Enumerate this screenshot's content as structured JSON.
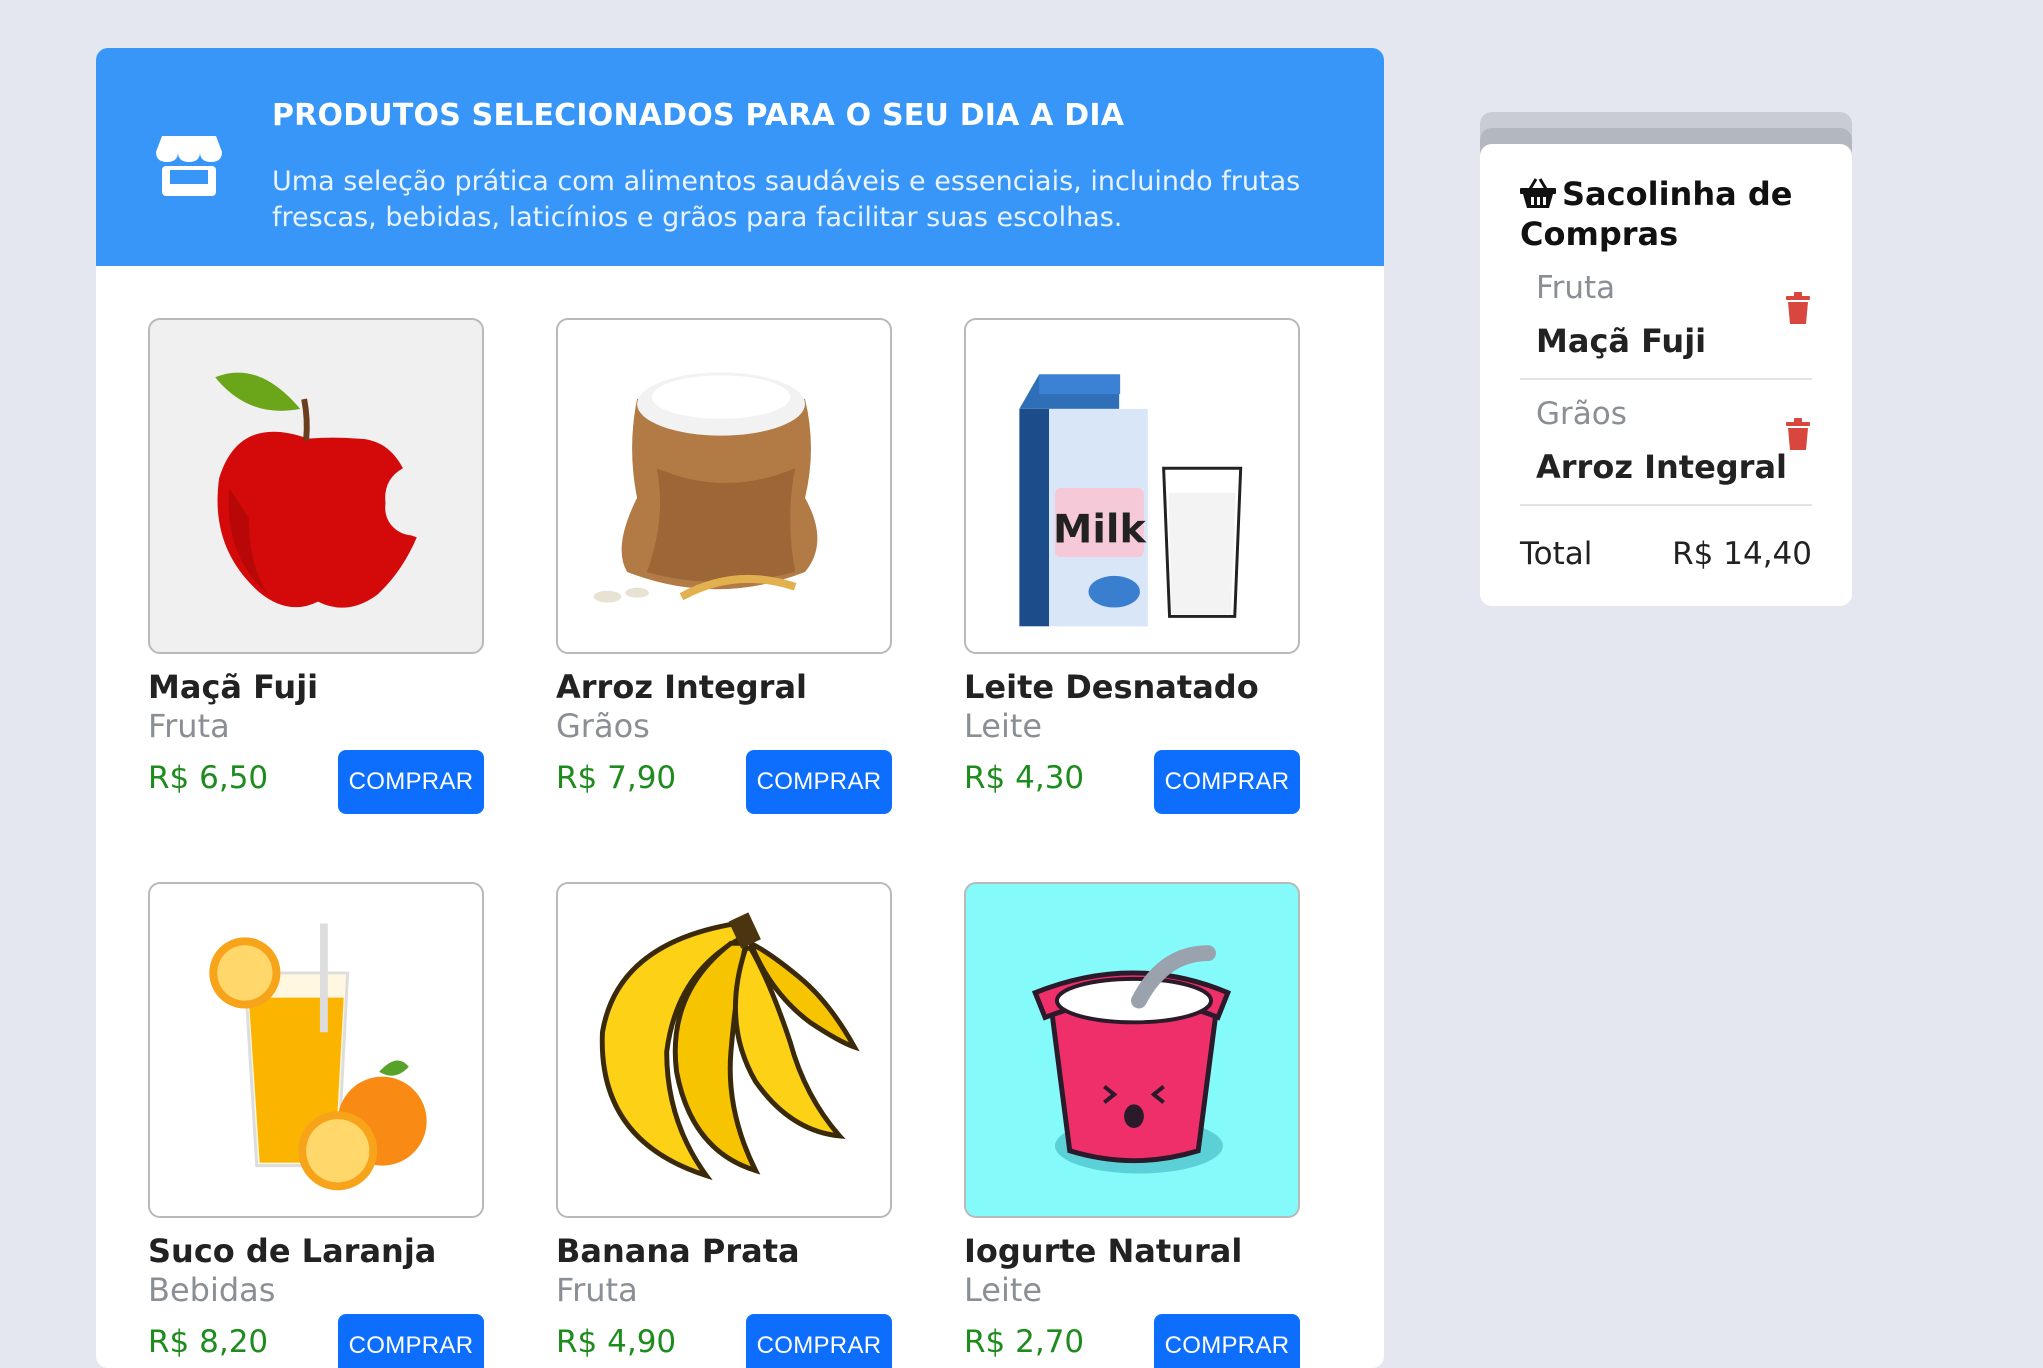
{
  "header": {
    "title": "PRODUTOS SELECIONADOS PARA O SEU DIA A DIA",
    "description": "Uma seleção prática com alimentos saudáveis e essenciais, incluindo frutas frescas, bebidas, laticínios e grãos para facilitar suas escolhas.",
    "icon": "store-icon"
  },
  "products": [
    {
      "name": "Maçã Fuji",
      "category": "Fruta",
      "price": "R$ 6,50",
      "button": "COMPRAR",
      "image": "apple"
    },
    {
      "name": "Arroz Integral",
      "category": "Grãos",
      "price": "R$ 7,90",
      "button": "COMPRAR",
      "image": "rice-sack"
    },
    {
      "name": "Leite Desnatado",
      "category": "Leite",
      "price": "R$ 4,30",
      "button": "COMPRAR",
      "image": "milk"
    },
    {
      "name": "Suco de Laranja",
      "category": "Bebidas",
      "price": "R$ 8,20",
      "button": "COMPRAR",
      "image": "orange-juice"
    },
    {
      "name": "Banana Prata",
      "category": "Fruta",
      "price": "R$ 4,90",
      "button": "COMPRAR",
      "image": "banana"
    },
    {
      "name": "Iogurte Natural",
      "category": "Leite",
      "price": "R$ 2,70",
      "button": "COMPRAR",
      "image": "yogurt"
    }
  ],
  "milk_label": "Milk",
  "cart": {
    "title": "Sacolinha de Compras",
    "icon": "basket-icon",
    "items": [
      {
        "category": "Fruta",
        "name": "Maçã Fuji"
      },
      {
        "category": "Grãos",
        "name": "Arroz Integral"
      }
    ],
    "total_label": "Total",
    "total_value": "R$ 14,40"
  },
  "colors": {
    "header_bg": "#3796f8",
    "button_bg": "#0d6efd",
    "price": "#1d8c1d",
    "trash": "#d9463e",
    "page_bg": "#e4e7f0"
  }
}
